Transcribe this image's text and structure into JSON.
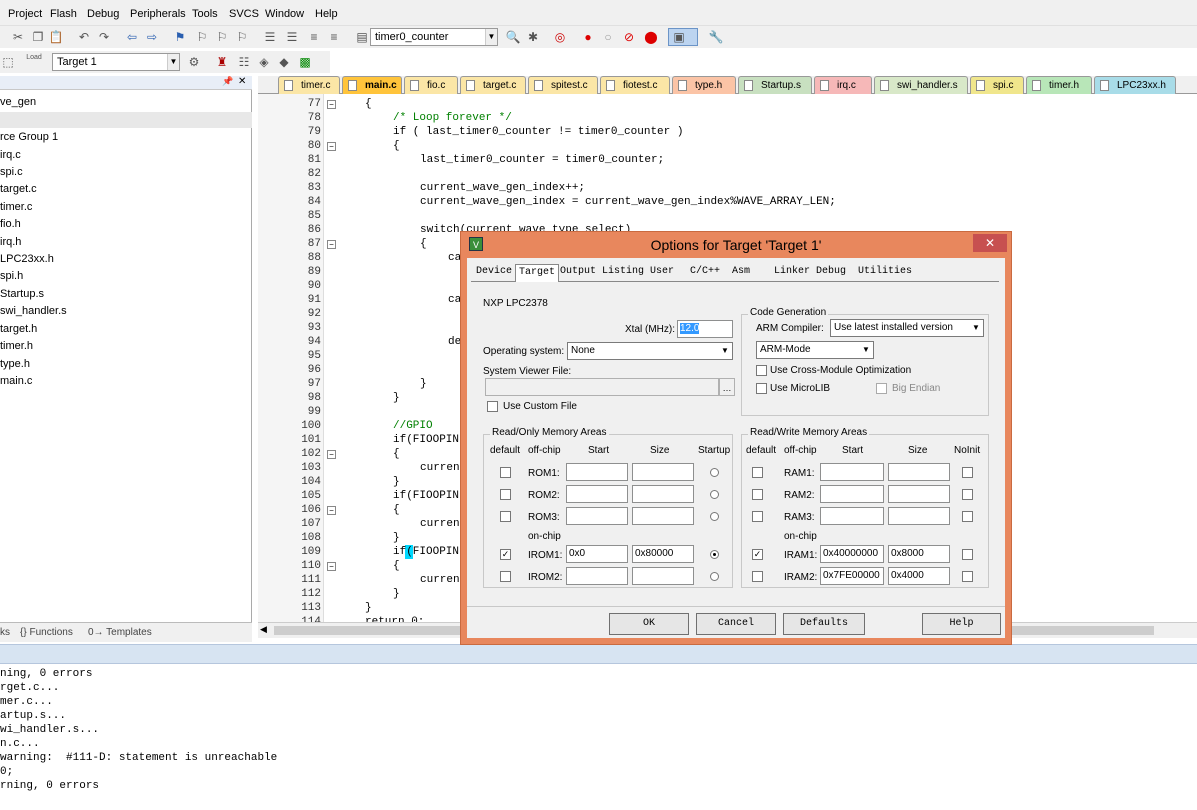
{
  "menu": [
    "Project",
    "Flash",
    "Debug",
    "Peripherals",
    "Tools",
    "SVCS",
    "Window",
    "Help"
  ],
  "toolbar": {
    "function_combo": "timer0_counter",
    "target_combo": "Target 1",
    "load_label": "Load"
  },
  "project": {
    "items": [
      "ve_gen",
      "",
      "rce Group 1",
      "irq.c",
      "spi.c",
      "target.c",
      "timer.c",
      "fio.h",
      "irq.h",
      "LPC23xx.h",
      "spi.h",
      "Startup.s",
      "swi_handler.s",
      "target.h",
      "timer.h",
      "type.h",
      "main.c"
    ],
    "tabs": [
      "ks",
      "{} Functions",
      "0→ Templates"
    ]
  },
  "file_tabs": [
    "timer.c",
    "main.c",
    "fio.c",
    "target.c",
    "spitest.c",
    "fiotest.c",
    "type.h",
    "Startup.s",
    "irq.c",
    "swi_handler.s",
    "spi.c",
    "timer.h",
    "LPC23xx.h"
  ],
  "code": {
    "line_numbers": [
      "77",
      "78",
      "79",
      "80",
      "81",
      "82",
      "83",
      "84",
      "85",
      "86",
      "87",
      "88",
      "89",
      "90",
      "91",
      "92",
      "93",
      "94",
      "95",
      "96",
      "97",
      "98",
      "99",
      "100",
      "101",
      "102",
      "103",
      "104",
      "105",
      "106",
      "107",
      "108",
      "109",
      "110",
      "111",
      "112",
      "113",
      "114"
    ],
    "lines": [
      "{",
      "/* Loop forever */",
      "if ( last_timer0_counter != timer0_counter )",
      "{",
      "last_timer0_counter = timer0_counter;",
      "",
      "current_wave_gen_index++;",
      "current_wave_gen_index = current_wave_gen_index%WAVE_ARRAY_LEN;",
      "",
      "switch(current_wave_type_select)",
      "{",
      "ca",
      "",
      "ca",
      "",
      "",
      "de",
      "",
      "",
      "",
      "}",
      "}",
      "",
      "//GPIO",
      "if(FIOOPIN",
      "{",
      "curren",
      "}",
      "if(FIOOPIN",
      "{",
      "curren",
      "}",
      "if(FIOOPIN",
      "{",
      "curren",
      "}",
      "}",
      "return 0;"
    ]
  },
  "build_output": [
    "ning, 0 errors",
    "rget.c...",
    "mer.c...",
    "artup.s...",
    "wi_handler.s...",
    "n.c...",
    "warning:  #111-D: statement is unreachable",
    "0;",
    "rning, 0 errors"
  ],
  "dialog": {
    "title": "Options for Target 'Target 1'",
    "close": "✕",
    "tabs": [
      "Device",
      "Target",
      "Output",
      "Listing",
      "User",
      "C/C++",
      "Asm",
      "Linker",
      "Debug",
      "Utilities"
    ],
    "device_name": "NXP LPC2378",
    "xtal_label": "Xtal (MHz):",
    "xtal_value": "12.0",
    "os_label": "Operating system:",
    "os_value": "None",
    "svf_label": "System Viewer File:",
    "use_custom_file": "Use Custom File",
    "codegen": {
      "title": "Code Generation",
      "compiler_label": "ARM Compiler:",
      "compiler_value": "Use latest installed version",
      "mode_value": "ARM-Mode",
      "cross_module": "Use Cross-Module Optimization",
      "microlib": "Use MicroLIB",
      "big_endian": "Big Endian"
    },
    "ro": {
      "title": "Read/Only Memory Areas",
      "h_default": "default",
      "h_offchip": "off-chip",
      "h_start": "Start",
      "h_size": "Size",
      "h_startup": "Startup",
      "onchip": "on-chip",
      "rows": [
        {
          "name": "ROM1:",
          "start": "",
          "size": "",
          "default": false,
          "startup": false
        },
        {
          "name": "ROM2:",
          "start": "",
          "size": "",
          "default": false,
          "startup": false
        },
        {
          "name": "ROM3:",
          "start": "",
          "size": "",
          "default": false,
          "startup": false
        },
        {
          "name": "IROM1:",
          "start": "0x0",
          "size": "0x80000",
          "default": true,
          "startup": true
        },
        {
          "name": "IROM2:",
          "start": "",
          "size": "",
          "default": false,
          "startup": false
        }
      ]
    },
    "rw": {
      "title": "Read/Write Memory Areas",
      "h_default": "default",
      "h_offchip": "off-chip",
      "h_start": "Start",
      "h_size": "Size",
      "h_noinit": "NoInit",
      "onchip": "on-chip",
      "rows": [
        {
          "name": "RAM1:",
          "start": "",
          "size": "",
          "default": false
        },
        {
          "name": "RAM2:",
          "start": "",
          "size": "",
          "default": false
        },
        {
          "name": "RAM3:",
          "start": "",
          "size": "",
          "default": false
        },
        {
          "name": "IRAM1:",
          "start": "0x40000000",
          "size": "0x8000",
          "default": true
        },
        {
          "name": "IRAM2:",
          "start": "0x7FE00000",
          "size": "0x4000",
          "default": false
        }
      ]
    },
    "buttons": {
      "ok": "OK",
      "cancel": "Cancel",
      "defaults": "Defaults",
      "help": "Help"
    }
  }
}
